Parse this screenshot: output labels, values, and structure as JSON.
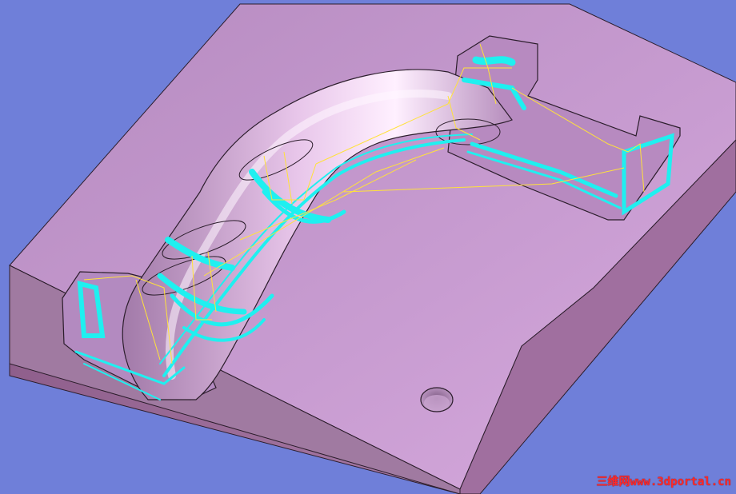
{
  "viewport": {
    "background_color": "#6f7fd9",
    "part_colors": {
      "top_face": "#c79bd0",
      "front_face": "#9e6e9b",
      "left_face": "#8a5f86",
      "pocket_floor": "#b98cc0",
      "toolpath_cyan": "#1ff0f0",
      "toolpath_yellow": "#ffe23a",
      "edge": "#2b1d2b"
    }
  },
  "watermark": {
    "text": "三维网www.3dportal.cn",
    "color": "#ff2a2a"
  }
}
